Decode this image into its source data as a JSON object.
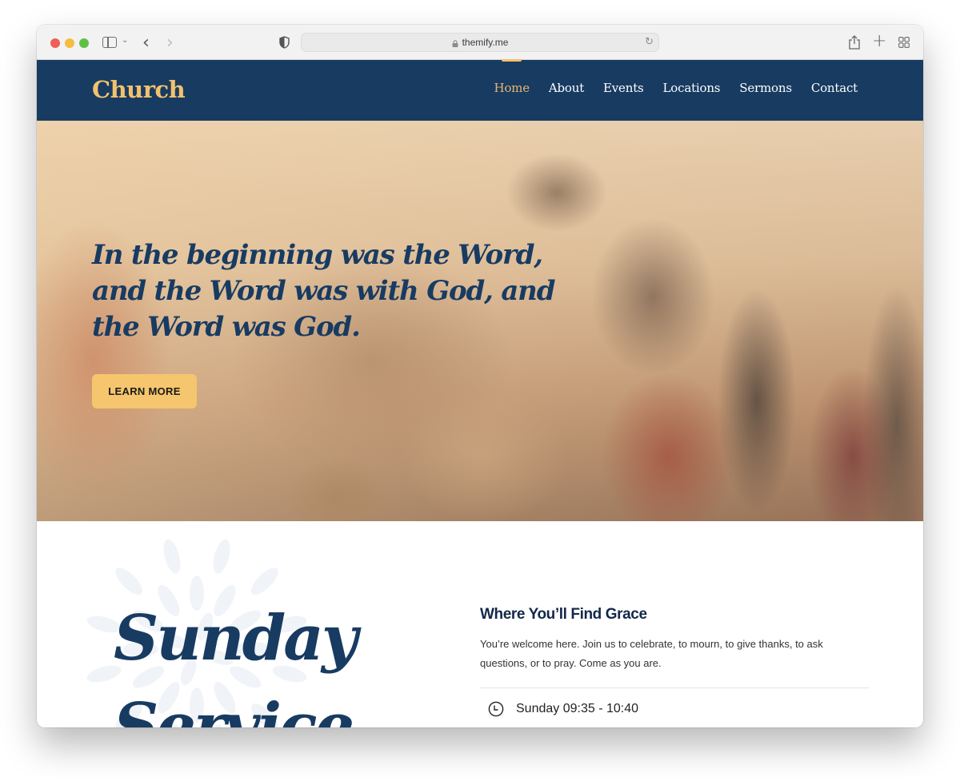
{
  "browser": {
    "url": "themify.me",
    "icons": {
      "sidebar": "sidebar-icon",
      "chevron": "chevron-down-icon",
      "back": "chevron-left-icon",
      "forward": "chevron-right-icon",
      "shield": "shield-icon",
      "lock": "lock-icon",
      "reload": "reload-icon",
      "share": "share-icon",
      "new_tab": "plus-icon",
      "tab_overview": "grid-icon"
    },
    "glyphs": {
      "chevron": "⌄",
      "back": "‹",
      "forward": "›",
      "reload": "↻",
      "new_tab": "+"
    }
  },
  "site": {
    "logo": "Church",
    "nav": [
      {
        "label": "Home",
        "active": true
      },
      {
        "label": "About",
        "active": false
      },
      {
        "label": "Events",
        "active": false
      },
      {
        "label": "Locations",
        "active": false
      },
      {
        "label": "Sermons",
        "active": false
      },
      {
        "label": "Contact",
        "active": false
      }
    ]
  },
  "hero": {
    "title": "In the beginning was the Word, and the Word was with God, and the Word was God.",
    "button_label": "LEARN MORE"
  },
  "service": {
    "big_title_line1": "Sunday",
    "big_title_line2": "Service",
    "info_title": "Where You’ll Find Grace",
    "info_text": "You’re welcome here. Join us to celebrate, to mourn, to give thanks, to ask questions, or to pray. Come as you are.",
    "time": "Sunday 09:35 - 10:40",
    "time_icon": "clock-icon"
  },
  "colors": {
    "header_bg": "#183b62",
    "accent_gold": "#f2c26b",
    "button_bg": "#f5c66d",
    "title_navy": "#183b62"
  }
}
